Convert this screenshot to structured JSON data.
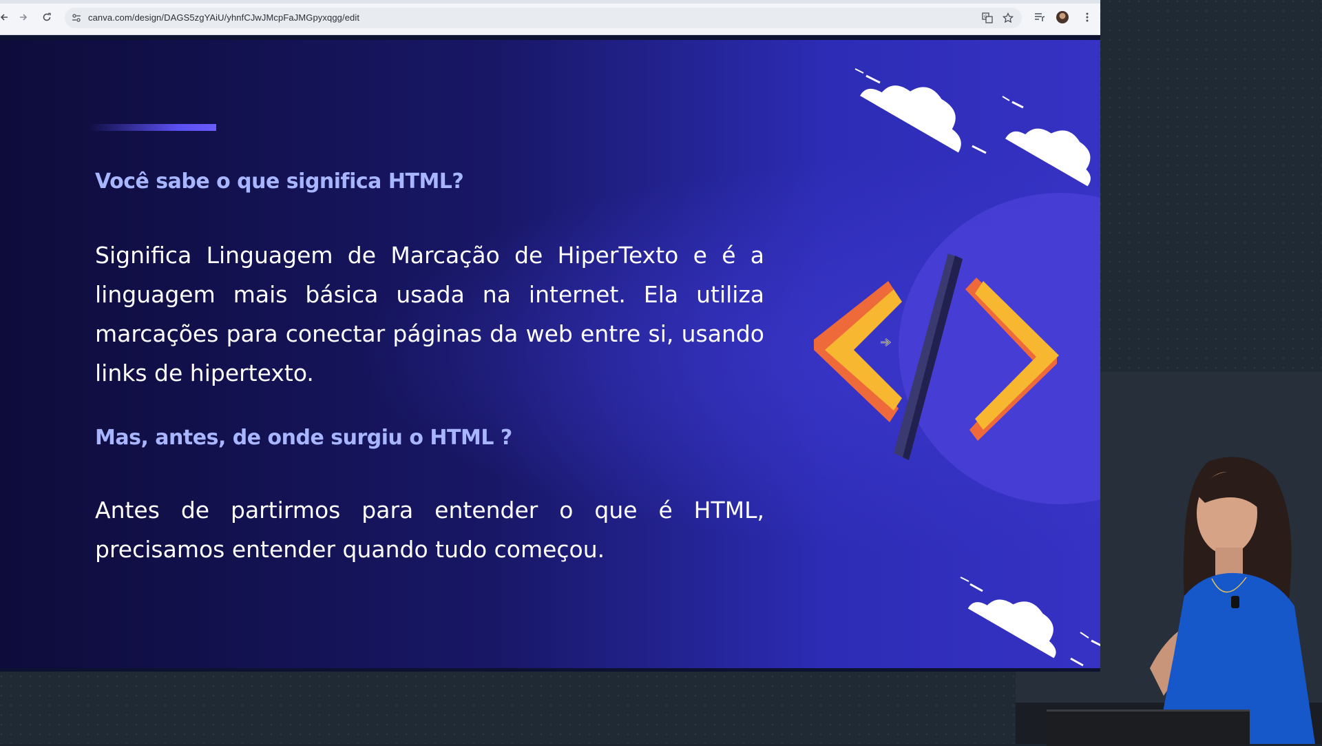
{
  "browser": {
    "url": "canva.com/design/DAGS5zgYAiU/yhnfCJwJMcpFaJMGpyxqgg/edit",
    "icons": {
      "back": "back-arrow-icon",
      "forward": "forward-arrow-icon",
      "reload": "reload-icon",
      "site_settings": "site-settings-icon",
      "translate": "translate-icon",
      "bookmark": "star-icon",
      "media": "media-controls-icon",
      "profile": "avatar",
      "menu": "kebab-menu-icon"
    }
  },
  "slide": {
    "question_1": "Você sabe o que significa HTML?",
    "paragraph_1": "Significa Linguagem de Marcação de HiperTexto e é a linguagem mais básica usada na internet. Ela utiliza marcações para conectar páginas da web entre si, usando links de hipertexto.",
    "question_2": "Mas, antes, de onde surgiu o HTML ?",
    "paragraph_2": "Antes de partirmos para entender o que é HTML, precisamos entender quando tudo começou.",
    "illustration": "code-brackets-icon",
    "colors": {
      "background_left": "#0e0c3a",
      "background_right": "#3632c4",
      "heading": "#a7b6ff",
      "body_text": "#ffffff",
      "accent_bar": "#5a4ff0",
      "bracket_yellow": "#f7b731",
      "bracket_orange": "#ef6a3a"
    }
  }
}
